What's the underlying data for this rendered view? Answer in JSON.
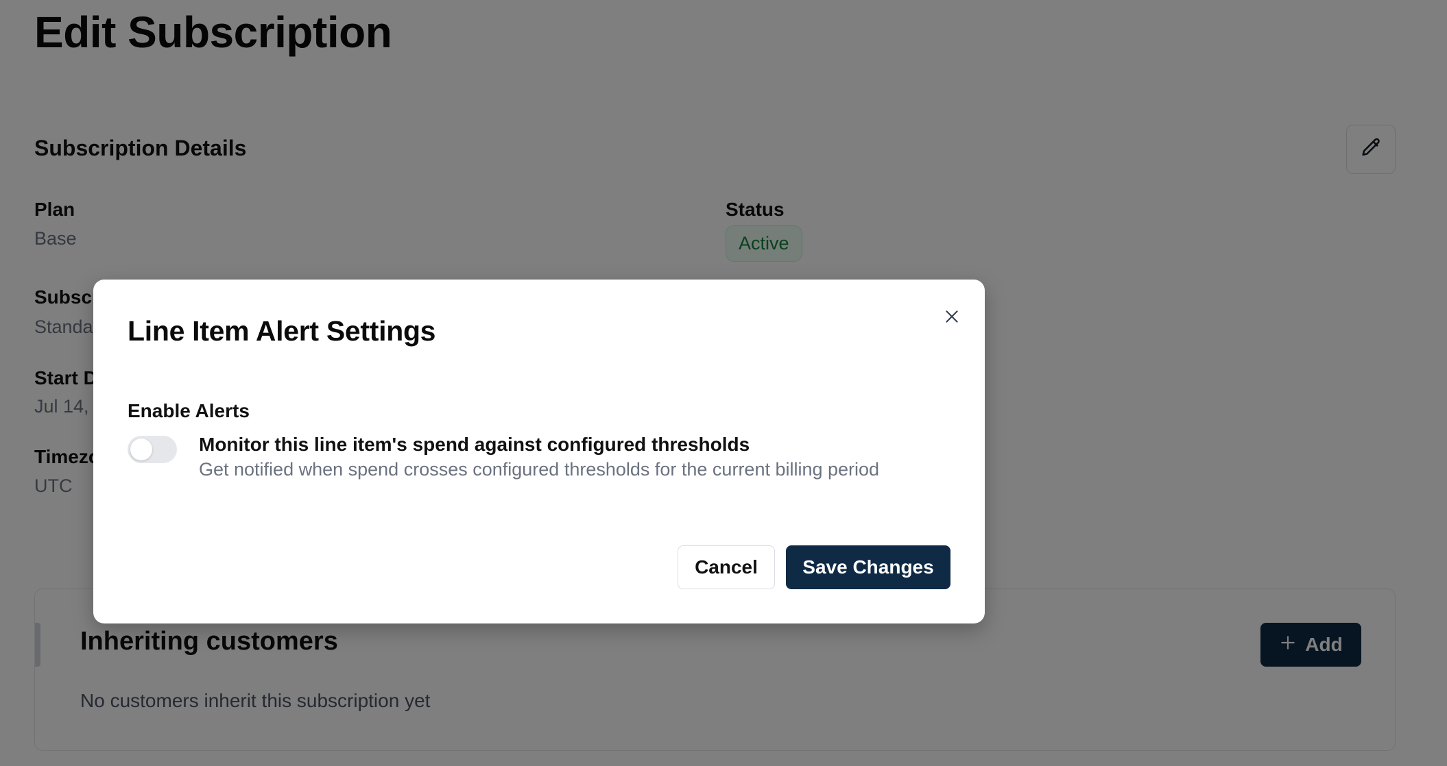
{
  "page": {
    "title": "Edit Subscription"
  },
  "details": {
    "section_title": "Subscription Details",
    "edit_icon": "pencil-icon",
    "fields": {
      "plan": {
        "label": "Plan",
        "value": "Base"
      },
      "status": {
        "label": "Status",
        "value": "Active"
      },
      "subscription": {
        "label": "Subscription",
        "value": "Standard"
      },
      "start_date": {
        "label": "Start Date",
        "value": "Jul 14,"
      },
      "timezone": {
        "label": "Timezone",
        "value": "UTC"
      }
    }
  },
  "inheriting": {
    "title": "Inheriting customers",
    "empty_text": "No customers inherit this subscription yet",
    "add_label": "Add",
    "add_icon": "plus-icon"
  },
  "modal": {
    "title": "Line Item Alert Settings",
    "close_icon": "close-icon",
    "enable_label": "Enable Alerts",
    "toggle_enabled": false,
    "toggle_title": "Monitor this line item's spend against configured thresholds",
    "toggle_description": "Get notified when spend crosses configured thresholds for the current billing period",
    "cancel_label": "Cancel",
    "save_label": "Save Changes"
  },
  "colors": {
    "primary": "#0f2a44",
    "status_active_bg": "#ecfdf3",
    "status_active_text": "#15803d",
    "overlay": "rgba(0,0,0,0.5)"
  }
}
